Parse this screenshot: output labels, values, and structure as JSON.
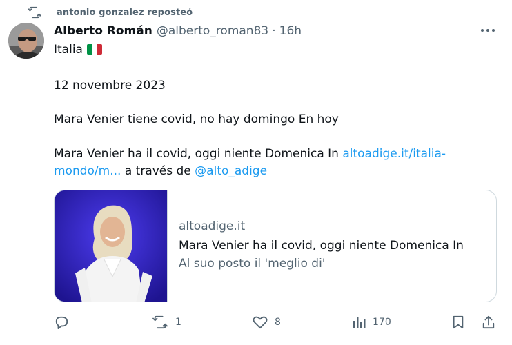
{
  "repost": {
    "text": "antonio gonzalez reposteó",
    "icon": "repost-icon"
  },
  "author": {
    "name": "Alberto Román",
    "handle": "@alberto_roman83",
    "separator": "·",
    "time": "16h"
  },
  "tweet": {
    "line1": "Italia",
    "flag_colors": [
      "#009246",
      "#ffffff",
      "#ce2b37"
    ],
    "line2": "12 novembre 2023",
    "line3": "Mara Venier tiene covid, no hay domingo En hoy",
    "line4_text": "Mara Venier ha il covid, oggi niente Domenica In ",
    "line4_link": "altoadige.it/italia-",
    "line5_link": "mondo/m...",
    "line5_text": " a través de ",
    "line5_mention": "@alto_adige"
  },
  "card": {
    "domain": "altoadige.it",
    "title": "Mara Venier ha il covid, oggi niente Domenica In",
    "description": "Al suo posto il 'meglio di'"
  },
  "actions": {
    "reply": {
      "icon": "reply-icon",
      "count": ""
    },
    "repost": {
      "icon": "repost-icon",
      "count": "1"
    },
    "like": {
      "icon": "heart-icon",
      "count": "8"
    },
    "views": {
      "icon": "views-icon",
      "count": "170"
    },
    "bookmark": {
      "icon": "bookmark-icon"
    },
    "share": {
      "icon": "share-icon"
    }
  },
  "colors": {
    "text": "#0f1419",
    "secondary": "#536471",
    "link": "#1d9bf0",
    "border": "#cfd9de"
  }
}
